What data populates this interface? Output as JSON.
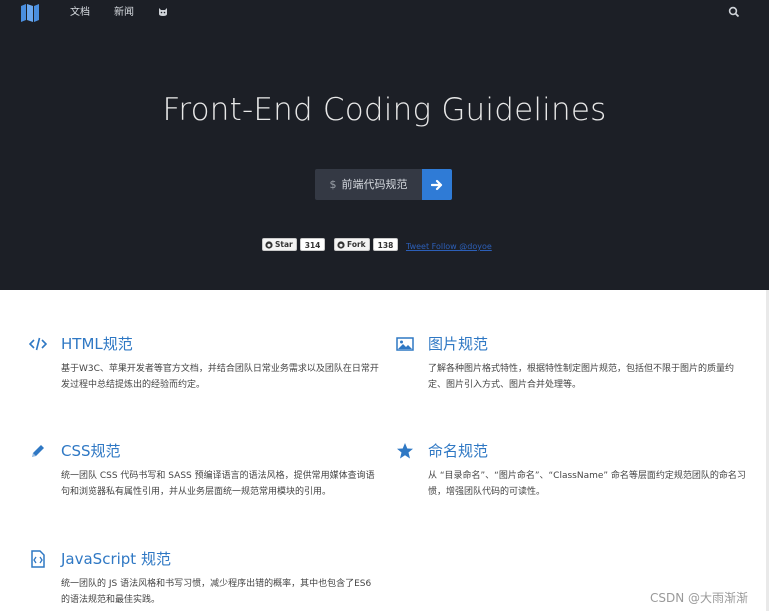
{
  "nav": {
    "links": [
      "文档",
      "新闻"
    ],
    "github_icon": "github-cat-icon",
    "search_icon": "search-icon",
    "logo_icon": "map-book-icon"
  },
  "hero": {
    "title": "Front-End Coding Guidelines",
    "cta": {
      "prefix": "$",
      "label": "前端代码规范",
      "arrow_icon": "arrow-right-icon"
    },
    "badges": [
      {
        "label": "Star",
        "count": "314",
        "icon": "github-icon"
      },
      {
        "label": "Fork",
        "count": "138",
        "icon": "github-icon"
      }
    ],
    "tweet_link": "Tweet Follow @doyoe"
  },
  "features": [
    {
      "icon": "code-icon",
      "title": "HTML规范",
      "desc": "基于W3C、苹果开发者等官方文档，并结合团队日常业务需求以及团队在日常开发过程中总结提炼出的经验而约定。"
    },
    {
      "icon": "image-icon",
      "title": "图片规范",
      "desc": "了解各种图片格式特性，根据特性制定图片规范，包括但不限于图片的质量约定、图片引入方式、图片合并处理等。"
    },
    {
      "icon": "pencil-icon",
      "title": "CSS规范",
      "desc": "统一团队 CSS 代码书写和 SASS 预编译语言的语法风格，提供常用媒体查询语句和浏览器私有属性引用，并从业务层面统一规范常用模块的引用。"
    },
    {
      "icon": "star-icon",
      "title": "命名规范",
      "desc": "从 “目录命名”、“图片命名”、“ClassName” 命名等层面约定规范团队的命名习惯，增强团队代码的可读性。"
    },
    {
      "icon": "js-file-icon",
      "title": "JavaScript 规范",
      "desc": "统一团队的 JS 语法风格和书写习惯，减少程序出错的概率，其中也包含了ES6 的语法规范和最佳实践。"
    }
  ],
  "watermark": "CSDN @大雨渐渐",
  "colors": {
    "hero_bg": "#1c1f26",
    "accent": "#2f78c4",
    "button": "#2f7bd6"
  }
}
